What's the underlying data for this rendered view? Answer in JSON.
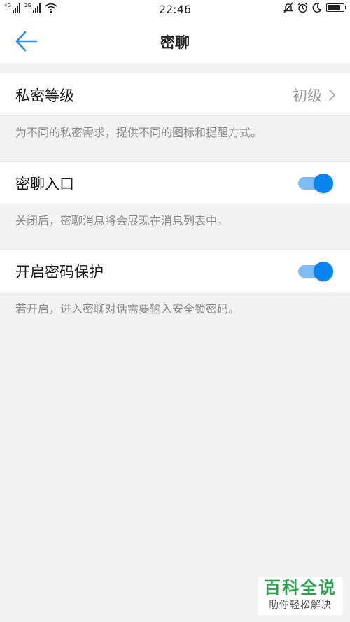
{
  "status_bar": {
    "sim1_label": "4G",
    "sim2_label": "2G",
    "time": "22:46",
    "battery_level": 0.85,
    "icons": [
      "signal-icon",
      "wifi-icon",
      "mute-bell-icon",
      "alarm-icon",
      "moon-icon",
      "battery-icon"
    ]
  },
  "header": {
    "title": "密聊",
    "back_icon": "back-arrow-icon"
  },
  "settings": {
    "privacy_level": {
      "label": "私密等级",
      "value": "初级",
      "hint": "为不同的私密需求，提供不同的图标和提醒方式。"
    },
    "entry": {
      "label": "密聊入口",
      "enabled": true,
      "hint": "关闭后，密聊消息将会展现在消息列表中。"
    },
    "password": {
      "label": "开启密码保护",
      "enabled": true,
      "hint": "若开启，进入密聊对话需要输入安全锁密码。"
    }
  },
  "watermark": {
    "main": "百科全说",
    "sub": "助你轻松解决"
  },
  "colors": {
    "accent": "#0a84ee",
    "toggle_track": "#7fbdf5",
    "watermark_green": "#2ca24c"
  }
}
